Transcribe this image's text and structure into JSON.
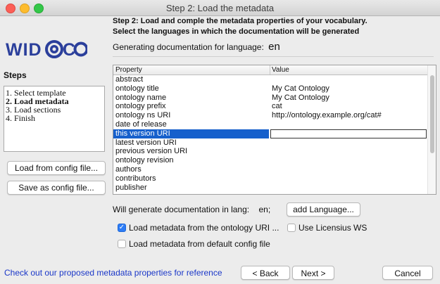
{
  "window": {
    "title": "Step 2: Load the metadata"
  },
  "logo": {
    "text": "WIDOCO"
  },
  "steps": {
    "title": "Steps",
    "items": [
      {
        "label": "1. Select template",
        "active": false
      },
      {
        "label": "2. Load metadata",
        "active": true
      },
      {
        "label": "3. Load sections",
        "active": false
      },
      {
        "label": "4. Finish",
        "active": false
      }
    ]
  },
  "side_buttons": {
    "load_config": "Load from config file...",
    "save_config": "Save as config file..."
  },
  "header": {
    "line1": "Step 2: Load and comple the metadata properties of your vocabulary.",
    "line2": "Select the languages in which the documentation will be generated",
    "generating_label": "Generating documentation for language:",
    "generating_lang": "en"
  },
  "table": {
    "col_property": "Property",
    "col_value": "Value",
    "rows": [
      {
        "property": "abstract",
        "value": ""
      },
      {
        "property": "ontology title",
        "value": "My Cat Ontology"
      },
      {
        "property": "ontology name",
        "value": "My Cat Ontology"
      },
      {
        "property": "ontology prefix",
        "value": "cat"
      },
      {
        "property": "ontology ns URI",
        "value": "http://ontology.example.org/cat#"
      },
      {
        "property": "date of release",
        "value": ""
      },
      {
        "property": "this version URI",
        "value": "",
        "selected": true
      },
      {
        "property": "latest version URI",
        "value": ""
      },
      {
        "property": "previous version URI",
        "value": ""
      },
      {
        "property": "ontology revision",
        "value": ""
      },
      {
        "property": "authors",
        "value": ""
      },
      {
        "property": "contributors",
        "value": ""
      },
      {
        "property": "publisher",
        "value": ""
      }
    ]
  },
  "languages": {
    "label": "Will generate documentation in lang:",
    "value": "en;",
    "add_button": "add Language..."
  },
  "options": {
    "load_from_uri": {
      "label": "Load metadata from the ontology URI ...",
      "checked": true
    },
    "use_licensius": {
      "label": "Use Licensius WS",
      "checked": false
    },
    "load_default_config": {
      "label": "Load metadata from default config file",
      "checked": false
    }
  },
  "footer": {
    "link": "Check out our proposed metadata properties for reference",
    "back": "< Back",
    "next": "Next >",
    "cancel": "Cancel"
  },
  "colors": {
    "selection": "#1660cc",
    "checkbox_on": "#2d7cf6",
    "link": "#1a37c8",
    "logo_blue": "#2b3f9b"
  },
  "icons": [
    "close-light",
    "minimize-light",
    "zoom-light",
    "checkmark-icon"
  ]
}
